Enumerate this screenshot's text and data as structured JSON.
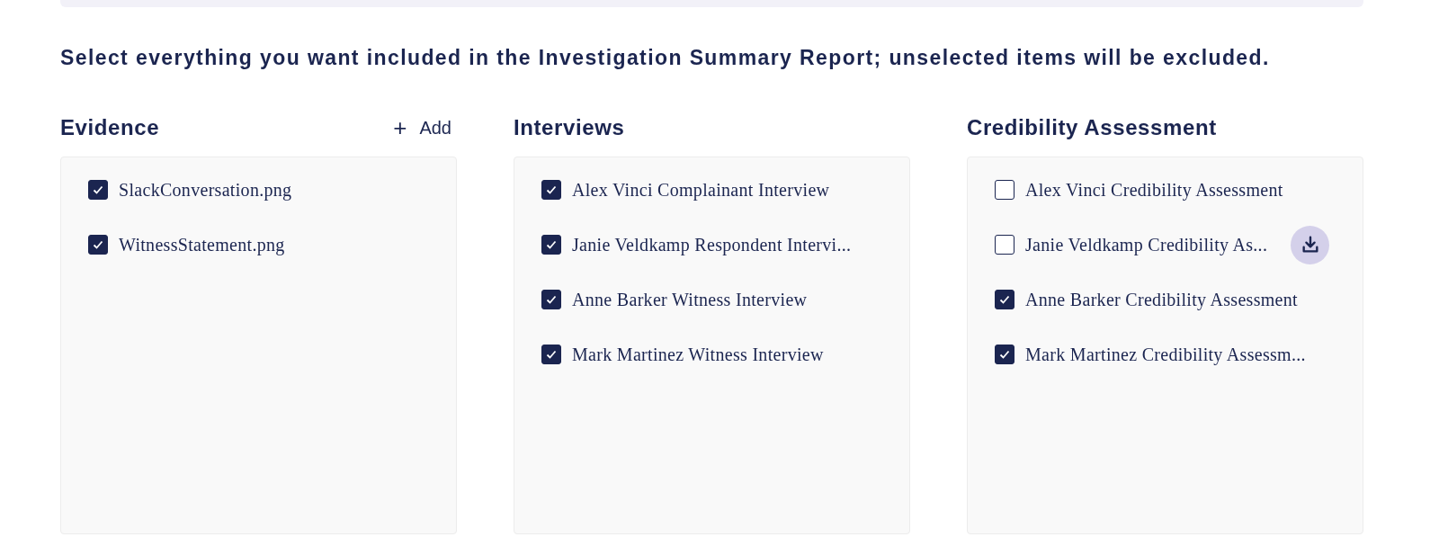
{
  "instruction": "Select everything you want included in the Investigation Summary Report; unselected items will be excluded.",
  "columns": [
    {
      "title": "Evidence",
      "add_action": {
        "icon": "+",
        "label": "Add"
      },
      "items": [
        {
          "label": "SlackConversation.png",
          "checked": true
        },
        {
          "label": "WitnessStatement.png",
          "checked": true
        }
      ]
    },
    {
      "title": "Interviews",
      "items": [
        {
          "label": "Alex Vinci Complainant Interview",
          "checked": true
        },
        {
          "label": "Janie Veldkamp Respondent Intervi...",
          "checked": true
        },
        {
          "label": "Anne Barker Witness Interview",
          "checked": true
        },
        {
          "label": "Mark Martinez Witness Interview",
          "checked": true
        }
      ]
    },
    {
      "title": "Credibility Assessment",
      "items": [
        {
          "label": "Alex Vinci Credibility Assessment",
          "checked": false
        },
        {
          "label": "Janie Veldkamp Credibility As...",
          "checked": false,
          "download_button": true
        },
        {
          "label": "Anne Barker Credibility Assessment",
          "checked": true
        },
        {
          "label": "Mark Martinez Credibility Assessm...",
          "checked": true
        }
      ]
    }
  ]
}
